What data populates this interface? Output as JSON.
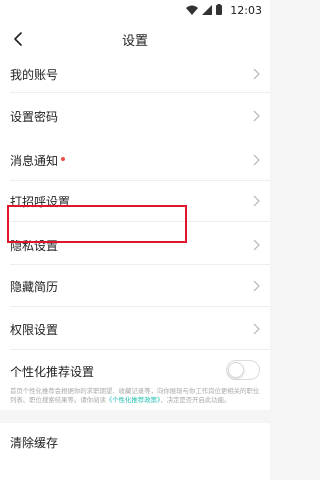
{
  "status": {
    "time": "12:03"
  },
  "nav": {
    "title": "设置"
  },
  "items": [
    {
      "label": "我的账号"
    },
    {
      "label": "设置密码"
    },
    {
      "label": "消息通知"
    },
    {
      "label": "打招呼设置"
    },
    {
      "label": "隐私设置"
    },
    {
      "label": "隐藏简历"
    },
    {
      "label": "权限设置"
    },
    {
      "label": "个性化推荐设置"
    },
    {
      "label": "清除缓存"
    }
  ],
  "personalization": {
    "toggle_on": false,
    "desc_before": "首页个性化推荐会根据你的求职期望、收藏记录等，向你展现与你工作岗位更相关的职位列表、职位搜索结果等。请你阅读",
    "desc_link": "《个性化推荐政策》",
    "desc_after": "，决定是否开启此功能。"
  },
  "colors": {
    "highlight": "#e0152a",
    "notify_dot": "#f24c4c",
    "link": "#1fbfb0"
  }
}
